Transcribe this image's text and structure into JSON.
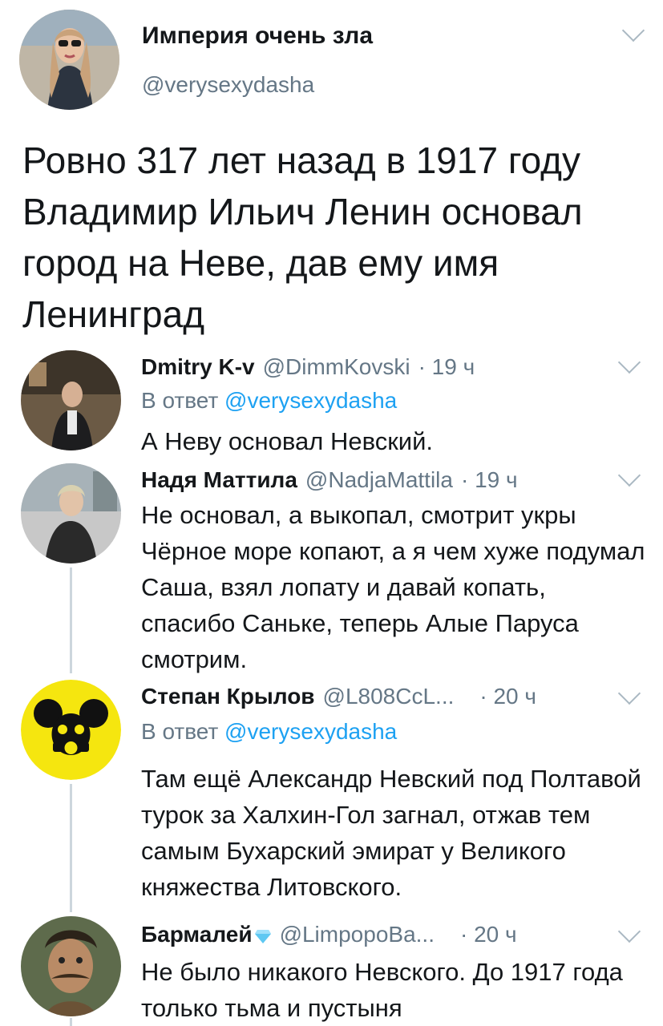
{
  "main_tweet": {
    "display_name": "Империя очень зла",
    "handle": "@verysexydasha",
    "text": "Ровно 317 лет назад в 1917 году Владимир Ильич Ленин основал город на Неве, дав ему имя Ленинград",
    "avatar_icon": "user-avatar-photo"
  },
  "replies": [
    {
      "display_name": "Dmitry K-v",
      "handle": "@DimmKovski",
      "time": "· 19 ч",
      "reply_to_prefix": "В ответ",
      "reply_to_handle": "@verysexydasha",
      "text": "А Неву основал Невский."
    },
    {
      "display_name": "Надя Маттила",
      "handle": "@NadjaMattila",
      "time": "· 19 ч",
      "text": "Не основал, а выкопал, смотрит укры Чёрное море копают, а я чем хуже подумал Саша, взял лопату и давай копать, спасибо Саньке, теперь Алые Паруса смотрим."
    },
    {
      "display_name": "Степан Крылов",
      "handle": "@L808CcL...",
      "time": "· 20 ч",
      "reply_to_prefix": "В ответ",
      "reply_to_handle": "@verysexydasha",
      "text": "Там ещё Александр Невский под Полтавой турок за Халхин-Гол загнал, отжав тем самым Бухарский эмират у Великого княжества Литовского."
    },
    {
      "display_name": "Бармалей",
      "handle": "@LimpopoBa...",
      "time": "· 20 ч",
      "text": "Не было никакого Невского. До 1917 года только тьма и пустыня"
    }
  ],
  "colors": {
    "text": "#14171a",
    "secondary": "#657786",
    "link": "#1da1f2",
    "thread_line": "#ccd6dd"
  }
}
